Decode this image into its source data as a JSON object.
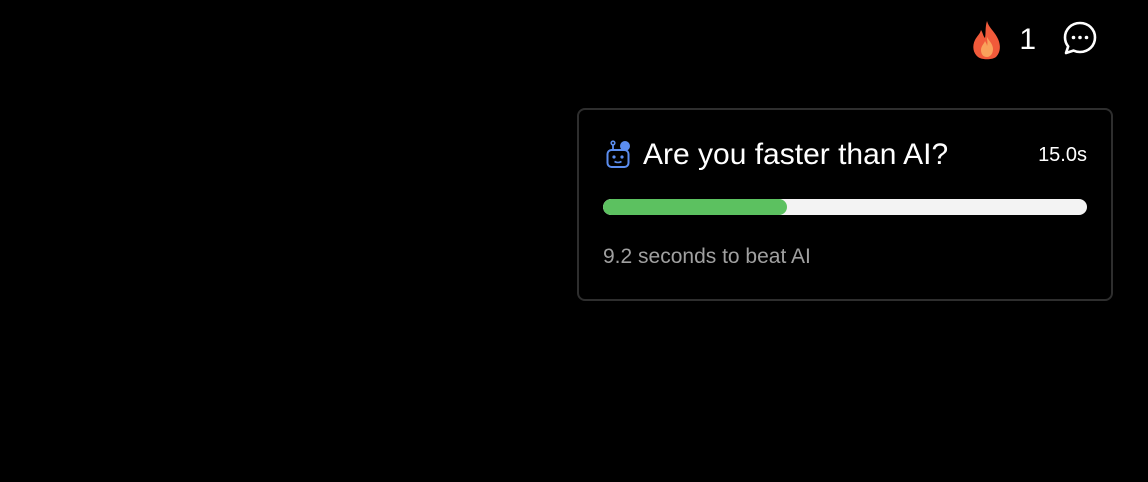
{
  "header": {
    "streak_icon": "fire-icon",
    "streak_count": "1",
    "chat_icon": "chat-bubble-icon"
  },
  "challenge_card": {
    "icon": "robot-icon",
    "title": "Are you faster than AI?",
    "timer": "15.0s",
    "progress_fraction": 0.38,
    "subtext": "9.2 seconds to beat AI",
    "colors": {
      "progress_fill": "#5cc160",
      "progress_track": "#f3f3f3",
      "robot_icon": "#5b8def"
    }
  }
}
